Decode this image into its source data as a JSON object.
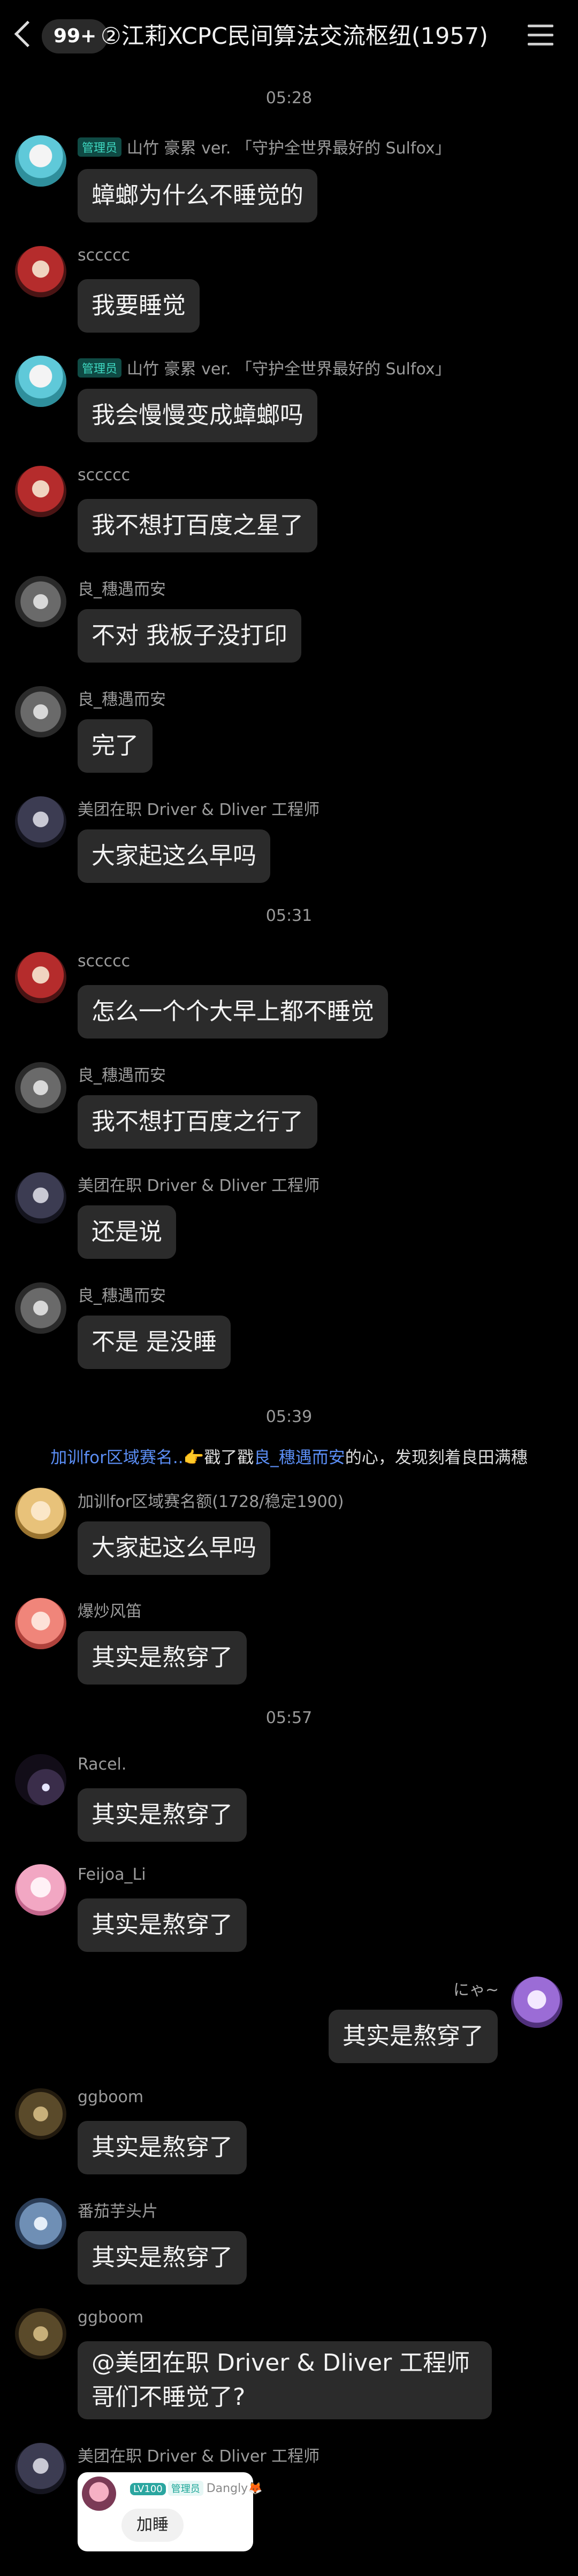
{
  "header": {
    "back_label": "‹",
    "unread_count": "99+",
    "title": "②江莉XCPC民间算法交流枢纽(1957)",
    "menu_icon": "menu-icon"
  },
  "times": {
    "t1": "05:28",
    "t2": "05:31",
    "t3": "05:39",
    "t4": "05:57"
  },
  "users": {
    "shanzhu": "山竹 豪累 ver. 「守护全世界最好的 Sulfox」",
    "sccccc": "sccccc",
    "liang": "良_穗遇而安",
    "meituan": "美团在职 Driver & Dliver 工程师",
    "jiaxun_full": "加训for区域赛名额(1728/稳定1900)",
    "baochao": "爆炒风笛",
    "racel": "Racel.",
    "feijoa": "Feijoa_Li",
    "nya": "にゃ~",
    "ggboom": "ggboom",
    "fanqie": "番茄芋头片"
  },
  "admin_badge": "管理员",
  "messages": {
    "m1": "蟑螂为什么不睡觉的",
    "m2": "我要睡觉",
    "m3": "我会慢慢变成蟑螂吗",
    "m4": "我不想打百度之星了",
    "m5": "不对 我板子没打印",
    "m6": "完了",
    "m7": "大家起这么早吗",
    "m8": "怎么一个个大早上都不睡觉",
    "m9": "我不想打百度之行了",
    "m10": "还是说",
    "m11": "不是 是没睡",
    "m12": "大家起这么早吗",
    "m13": "其实是熬穿了",
    "m14": "其实是熬穿了",
    "m15": "其实是熬穿了",
    "m16": "其实是熬穿了",
    "m17": "其实是熬穿了",
    "m18": "其实是熬穿了",
    "m19": "@美团在职 Driver & Dliver 工程师哥们不睡觉了?"
  },
  "notice": {
    "actor": "加训for区域赛名..",
    "emoji": "👉",
    "text1": "戳了戳",
    "target": "良_穗遇而安",
    "text2": "的心，发现刻着良田满穗"
  },
  "card": {
    "level": "LV100",
    "admin": "管理员",
    "user": "Dangly",
    "emoji": "🦊",
    "action": "加睡"
  }
}
